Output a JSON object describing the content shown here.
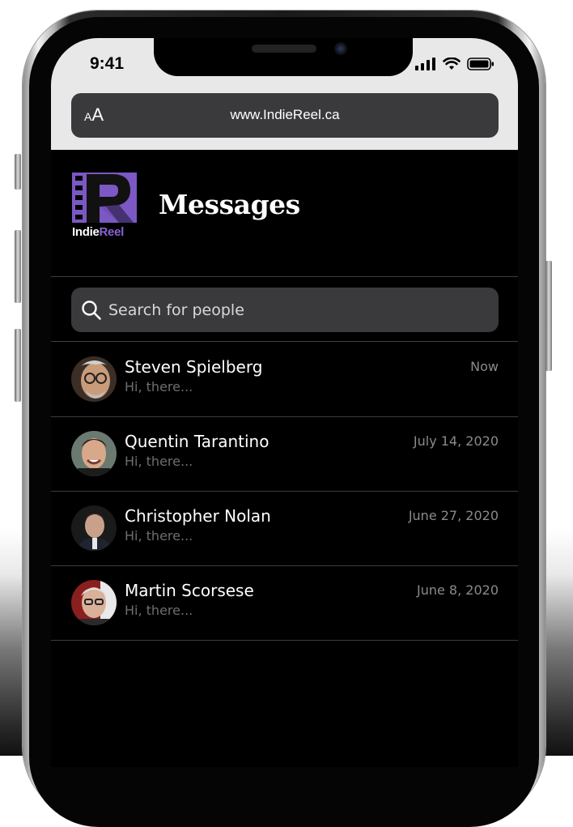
{
  "status_bar": {
    "time": "9:41"
  },
  "browser": {
    "text_size_small": "A",
    "text_size_large": "A",
    "url": "www.IndieReel.ca"
  },
  "header": {
    "logo_text_1": "Indie",
    "logo_text_2": "Reel",
    "title": "Messages"
  },
  "search": {
    "placeholder": "Search for people"
  },
  "conversations": [
    {
      "name": "Steven Spielberg",
      "preview": "Hi, there...",
      "date": "Now"
    },
    {
      "name": "Quentin Tarantino",
      "preview": "Hi, there...",
      "date": "July 14, 2020"
    },
    {
      "name": "Christopher Nolan",
      "preview": "Hi, there...",
      "date": "June 27, 2020"
    },
    {
      "name": "Martin Scorsese",
      "preview": "Hi, there...",
      "date": "June 8, 2020"
    }
  ],
  "colors": {
    "brand_purple": "#7b58c4",
    "screen_bg": "#000000",
    "field_bg": "#3a3a3c"
  }
}
